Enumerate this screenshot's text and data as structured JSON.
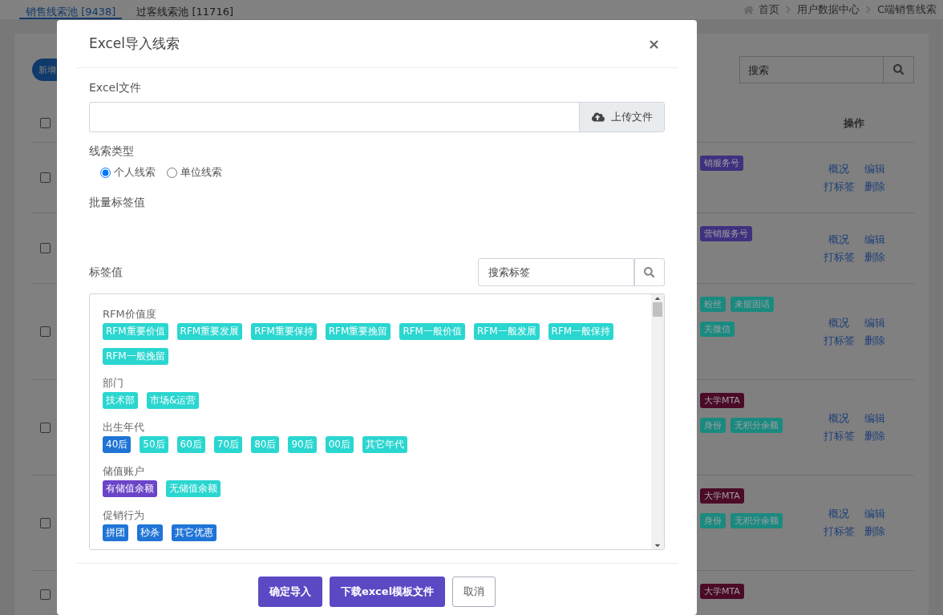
{
  "page_tabs": [
    {
      "label": "销售线索池 [9438]",
      "selected": true
    },
    {
      "label": "过客线索池 [11716]",
      "selected": false
    }
  ],
  "breadcrumb": [
    "首页",
    "用户数据中心",
    "C端销售线索"
  ],
  "toolbar": {
    "new_button": "新增",
    "search": {
      "placeholder": "搜索"
    }
  },
  "table": {
    "header_checked": false,
    "action_header": "操作",
    "rows": [
      {
        "checked": false,
        "tags": [
          [
            {
              "label": "销服务号",
              "color": "#40307f"
            }
          ]
        ],
        "actions": [
          "概况",
          "编辑",
          "打标签",
          "删除"
        ]
      },
      {
        "checked": false,
        "tags": [
          [
            {
              "label": "营销服务号",
              "color": "#40307f"
            }
          ]
        ],
        "actions": [
          "概况",
          "编辑",
          "打标签",
          "删除"
        ]
      },
      {
        "checked": false,
        "tags": [
          [
            {
              "label": "粉丝",
              "color": "#1a8a80"
            },
            {
              "label": "未留固话",
              "color": "#1a8a80"
            }
          ],
          [
            {
              "label": "关微信",
              "color": "#1a8a80"
            }
          ]
        ],
        "actions": [
          "概况",
          "编辑",
          "打标签",
          "删除"
        ]
      },
      {
        "checked": false,
        "tags": [
          [
            {
              "label": "大学MTA",
              "color": "#4b0a28"
            }
          ],
          [
            {
              "label": "身份",
              "color": "#1a8a80"
            },
            {
              "label": "无积分余额",
              "color": "#1a8a80"
            }
          ]
        ],
        "actions": [
          "概况",
          "编辑",
          "打标签",
          "删除"
        ]
      },
      {
        "checked": false,
        "tags": [
          [
            {
              "label": "大学MTA",
              "color": "#4b0a28"
            }
          ],
          [
            {
              "label": "身份",
              "color": "#1a8a80"
            },
            {
              "label": "无积分余额",
              "color": "#1a8a80"
            }
          ]
        ],
        "actions": [
          "概况",
          "编辑",
          "打标签",
          "删除"
        ]
      },
      {
        "checked": false,
        "tags": [
          [
            {
              "label": "大学MTA",
              "color": "#4b0a28"
            }
          ]
        ],
        "actions": []
      }
    ]
  },
  "modal": {
    "title": "Excel导入线索",
    "close": "×",
    "file_label": "Excel文件",
    "upload_button": "上传文件",
    "type_label": "线索类型",
    "types": [
      {
        "label": "个人线索",
        "selected": true
      },
      {
        "label": "单位线索",
        "selected": false
      }
    ],
    "batch_label": "批量标签值",
    "tag_label": "标签值",
    "tag_search": {
      "placeholder": "搜索标签"
    },
    "groups": [
      {
        "name": "RFM价值度",
        "tags": [
          {
            "label": "RFM重要价值",
            "color": "#2ad6d0"
          },
          {
            "label": "RFM重要发展",
            "color": "#2ad6d0"
          },
          {
            "label": "RFM重要保持",
            "color": "#2ad6d0"
          },
          {
            "label": "RFM重要挽留",
            "color": "#2ad6d0"
          },
          {
            "label": "RFM一般价值",
            "color": "#2ad6d0"
          },
          {
            "label": "RFM一般发展",
            "color": "#2ad6d0"
          },
          {
            "label": "RFM一般保持",
            "color": "#2ad6d0"
          },
          {
            "label": "RFM一般挽留",
            "color": "#2ad6d0"
          }
        ]
      },
      {
        "name": "部门",
        "tags": [
          {
            "label": "技术部",
            "color": "#2ad6d0"
          },
          {
            "label": "市场&运营",
            "color": "#2ad6d0"
          }
        ]
      },
      {
        "name": "出生年代",
        "tags": [
          {
            "label": "40后",
            "color": "#1f74d6"
          },
          {
            "label": "50后",
            "color": "#2ad6d0"
          },
          {
            "label": "60后",
            "color": "#2ad6d0"
          },
          {
            "label": "70后",
            "color": "#2ad6d0"
          },
          {
            "label": "80后",
            "color": "#2ad6d0"
          },
          {
            "label": "90后",
            "color": "#2ad6d0"
          },
          {
            "label": "00后",
            "color": "#2ad6d0"
          },
          {
            "label": "其它年代",
            "color": "#2ad6d0"
          }
        ]
      },
      {
        "name": "储值账户",
        "tags": [
          {
            "label": "有储值余额",
            "color": "#6a45c8"
          },
          {
            "label": "无储值余额",
            "color": "#2ad6d0"
          }
        ]
      },
      {
        "name": "促销行为",
        "tags": [
          {
            "label": "拼团",
            "color": "#1f74d6"
          },
          {
            "label": "秒杀",
            "color": "#1f74d6"
          },
          {
            "label": "其它优惠",
            "color": "#1f74d6"
          }
        ]
      }
    ],
    "buttons": [
      {
        "label": "确定导入",
        "kind": "primary"
      },
      {
        "label": "下载excel模板文件",
        "kind": "primary"
      },
      {
        "label": "取消",
        "kind": "outline"
      }
    ]
  }
}
